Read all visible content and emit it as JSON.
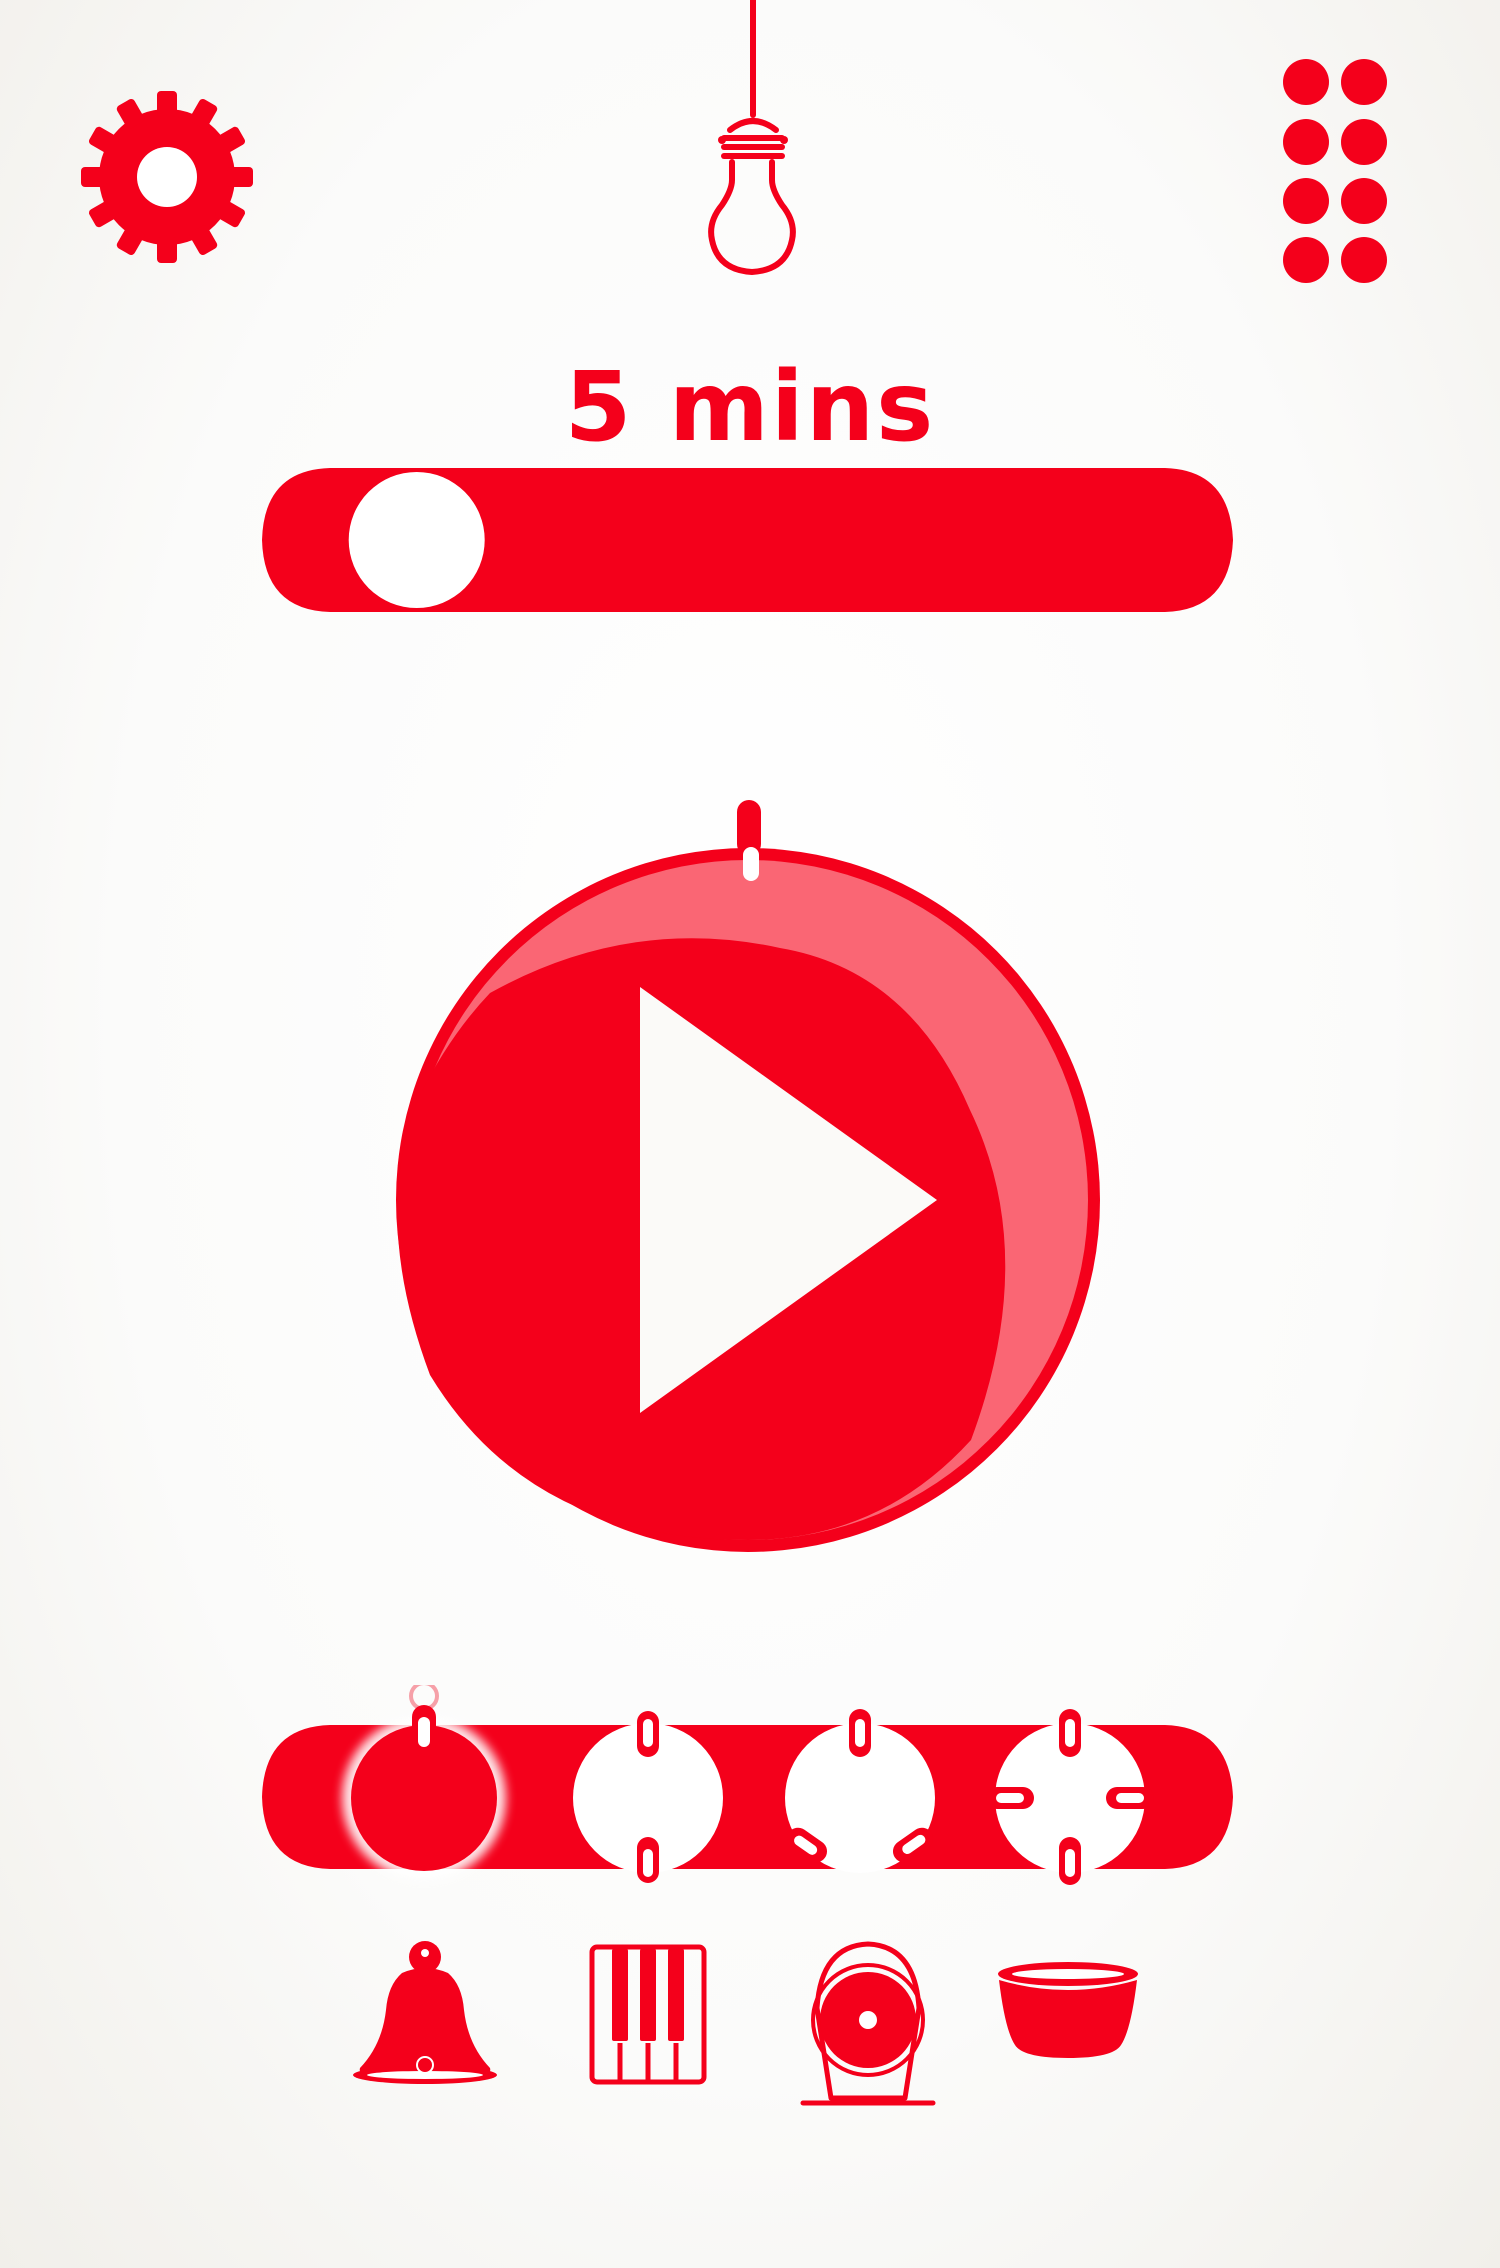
{
  "app": {
    "accent_color": "#f4001b",
    "light_accent_color": "#fa6674",
    "background_color": "#ffffff"
  },
  "toolbar": {
    "settings_icon": "gear-icon",
    "light_icon": "lightbulb-icon",
    "menu_icon": "grid-dots-icon"
  },
  "timer": {
    "duration_label": "5 mins",
    "slider_value_fraction": 0.1,
    "progress_fraction": 0.12
  },
  "play_button": {
    "icon": "play-icon"
  },
  "sound_patterns": {
    "selected_index": 0,
    "items": [
      {
        "icon": "single-strike-icon"
      },
      {
        "icon": "two-strike-icon"
      },
      {
        "icon": "three-strike-icon"
      },
      {
        "icon": "four-strike-icon"
      }
    ]
  },
  "sounds": {
    "items": [
      {
        "icon": "bell-icon"
      },
      {
        "icon": "xylophone-icon"
      },
      {
        "icon": "gong-icon"
      },
      {
        "icon": "singing-bowl-icon"
      }
    ]
  }
}
